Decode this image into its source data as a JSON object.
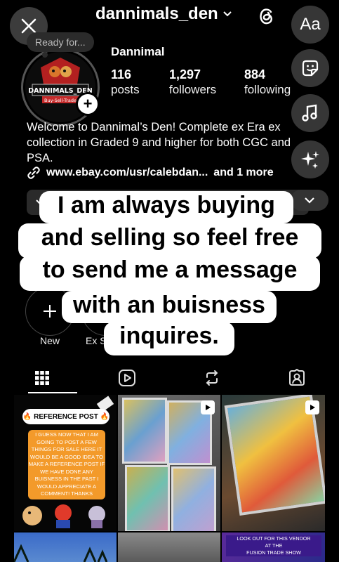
{
  "header": {
    "username": "dannimals_den",
    "note": "Ready for...",
    "display_name": "Dannimal",
    "logo_text": "DANNIMALS_DEN",
    "logo_sub": "Buy-Sell-Trade"
  },
  "editor_tools": {
    "text_label": "Aa"
  },
  "stats": [
    {
      "value": "116",
      "label": "posts"
    },
    {
      "value": "1,297",
      "label": "followers"
    },
    {
      "value": "884",
      "label": "following"
    }
  ],
  "bio": {
    "text": "Welcome to Dannimal’s Den! Complete ex Era ex collection in Graded 9 and higher for both CGC and PSA.",
    "link": "www.ebay.com/usr/calebdan...",
    "link_more": "and 1 more"
  },
  "caption": {
    "line1": "I am always buying",
    "line2": "and selling so feel free",
    "line3": "to send me a message",
    "line4": "with an buisness",
    "line5": "inquires."
  },
  "highlights": {
    "new_label": "New",
    "second_label_partial": "Ex S"
  },
  "tabs": [
    "grid-icon",
    "reels-icon",
    "reposts-icon",
    "tagged-icon"
  ],
  "posts": {
    "reference_title": "🔥 REFERENCE POST 🔥",
    "reference_body": "I GUESS NOW THAT I AM GOING TO POST A FEW THINGS FOR SALE HERE IT WOULD BE A GOOD IDEA TO MAKE A REFERENCE POST IF WE HAVE DONE ANY BUISNESS IN THE PAST I WOULD APPRECIATE A COMMENT! THANKS",
    "vendor_line1": "LOOK OUT FOR THIS VENDOR",
    "vendor_line2": "AT THE",
    "vendor_line3": "FUSION TRADE SHOW"
  },
  "colors": {
    "background": "#000000",
    "caption_bg": "#ffffff",
    "reference_orange": "#f39a2a"
  }
}
